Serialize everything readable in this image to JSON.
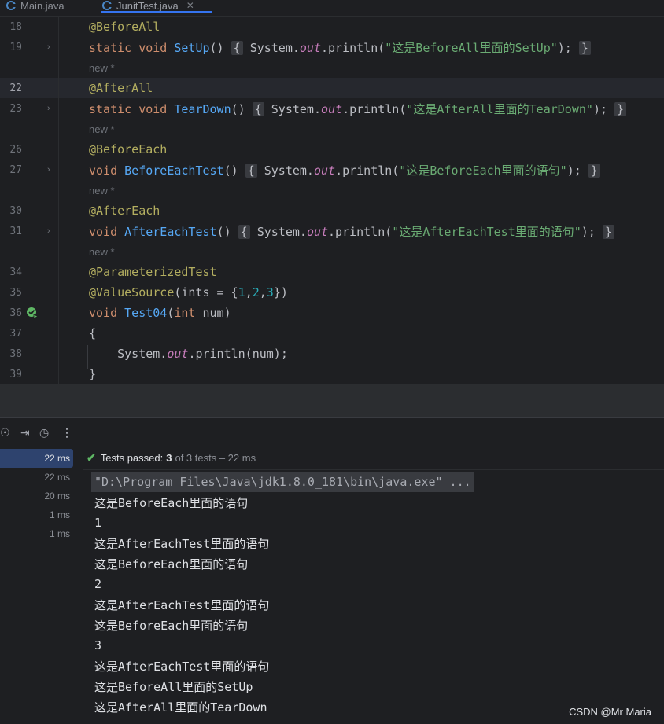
{
  "tabs": [
    {
      "label": "Main.java",
      "active": false
    },
    {
      "label": "JunitTest.java",
      "active": true
    }
  ],
  "editor": {
    "lines": [
      {
        "n": "18",
        "kind": "annotation",
        "text": "@BeforeAll"
      },
      {
        "n": "19",
        "kind": "method",
        "modifiers": "static void ",
        "name": "SetUp",
        "params": "() ",
        "body_pre": "System.",
        "body_out": "out",
        "body_call": ".println(",
        "body_str": "\"这是BeforeAll里面的SetUp\"",
        "body_end": ");",
        "close": "}"
      },
      {
        "n": "",
        "kind": "inlay",
        "text": "new *"
      },
      {
        "n": "22",
        "kind": "annotation",
        "text": "@AfterAll",
        "current": true
      },
      {
        "n": "23",
        "kind": "method",
        "modifiers": "static void ",
        "name": "TearDown",
        "params": "() ",
        "body_pre": "System.",
        "body_out": "out",
        "body_call": ".println(",
        "body_str": "\"这是AfterAll里面的TearDown\"",
        "body_end": ");",
        "close": "}"
      },
      {
        "n": "",
        "kind": "inlay",
        "text": "new *"
      },
      {
        "n": "26",
        "kind": "annotation",
        "text": "@BeforeEach"
      },
      {
        "n": "27",
        "kind": "method",
        "modifiers": "void ",
        "name": "BeforeEachTest",
        "params": "() ",
        "body_pre": "System.",
        "body_out": "out",
        "body_call": ".println(",
        "body_str": "\"这是BeforeEach里面的语句\"",
        "body_end": ");",
        "close": "}"
      },
      {
        "n": "",
        "kind": "inlay",
        "text": "new *"
      },
      {
        "n": "30",
        "kind": "annotation",
        "text": "@AfterEach"
      },
      {
        "n": "31",
        "kind": "method",
        "modifiers": "void ",
        "name": "AfterEachTest",
        "params": "() ",
        "body_pre": "System.",
        "body_out": "out",
        "body_call": ".println(",
        "body_str": "\"这是AfterEachTest里面的语句\"",
        "body_end": ");",
        "close": "}"
      },
      {
        "n": "",
        "kind": "inlay",
        "text": "new *"
      },
      {
        "n": "34",
        "kind": "annotation",
        "text": "@ParameterizedTest"
      },
      {
        "n": "35",
        "kind": "valuesource",
        "ann": "@ValueSource",
        "pre": "(ints = {",
        "nums": [
          "1",
          "2",
          "3"
        ],
        "post": "})"
      },
      {
        "n": "36",
        "kind": "test",
        "modifiers": "void ",
        "name": "Test04",
        "open": "(",
        "type": "int",
        "rest": " num)"
      },
      {
        "n": "37",
        "kind": "plain",
        "text": "{"
      },
      {
        "n": "38",
        "kind": "println",
        "pre": "    System.",
        "out": "out",
        "post": ".println(num);"
      },
      {
        "n": "39",
        "kind": "plain",
        "text": "}"
      }
    ]
  },
  "run": {
    "status_label": "Tests passed:",
    "passed": "3",
    "of_text": "of 3 tests – 22 ms",
    "tree_times": [
      "22 ms",
      "22 ms",
      "20 ms",
      "1 ms",
      "1 ms"
    ],
    "console": [
      "\"D:\\Program Files\\Java\\jdk1.8.0_181\\bin\\java.exe\" ...",
      "这是BeforeEach里面的语句",
      "1",
      "这是AfterEachTest里面的语句",
      "这是BeforeEach里面的语句",
      "2",
      "这是AfterEachTest里面的语句",
      "这是BeforeEach里面的语句",
      "3",
      "这是AfterEachTest里面的语句",
      "这是BeforeAll里面的SetUp",
      "这是AfterAll里面的TearDown"
    ]
  },
  "watermark": "CSDN @Mr Maria",
  "icons": {
    "tab_file": "java-class-icon",
    "fold": "chevron-right-icon",
    "run_gutter": "test-passed-run-icon",
    "status": "check-icon"
  }
}
